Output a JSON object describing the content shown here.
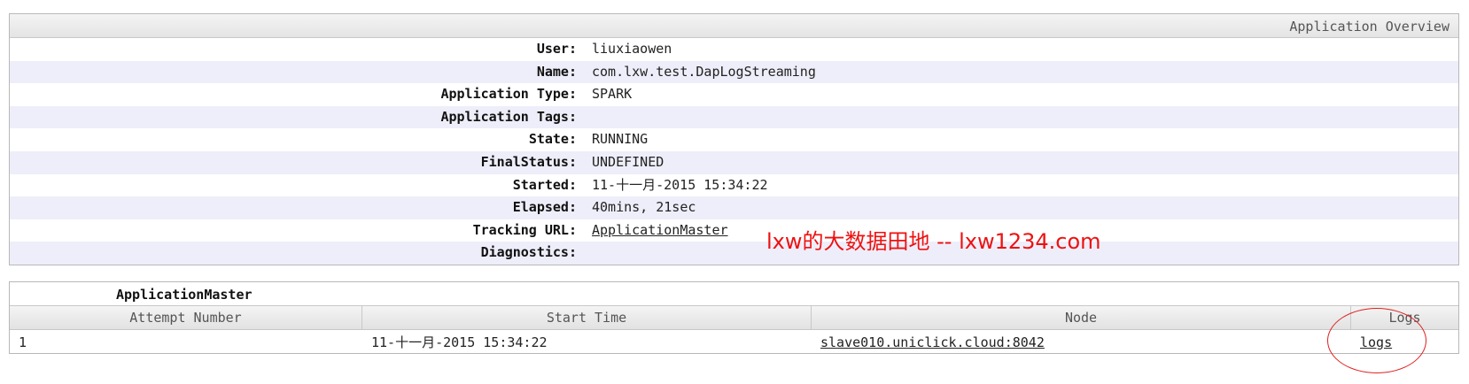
{
  "overview": {
    "header": "Application Overview",
    "rows": [
      {
        "label": "User:",
        "value": "liuxiaowen"
      },
      {
        "label": "Name:",
        "value": "com.lxw.test.DapLogStreaming"
      },
      {
        "label": "Application Type:",
        "value": "SPARK"
      },
      {
        "label": "Application Tags:",
        "value": ""
      },
      {
        "label": "State:",
        "value": "RUNNING"
      },
      {
        "label": "FinalStatus:",
        "value": "UNDEFINED"
      },
      {
        "label": "Started:",
        "value": "11-十一月-2015 15:34:22"
      },
      {
        "label": "Elapsed:",
        "value": "40mins, 21sec"
      },
      {
        "label": "Tracking URL:",
        "value": "ApplicationMaster"
      },
      {
        "label": "Diagnostics:",
        "value": ""
      }
    ]
  },
  "watermark": "lxw的大数据田地 -- lxw1234.com",
  "app_master": {
    "title": "ApplicationMaster",
    "columns": [
      "Attempt Number",
      "Start Time",
      "Node",
      "Logs"
    ],
    "rows": [
      {
        "attempt": "1",
        "start_time": "11-十一月-2015 15:34:22",
        "node": "slave010.uniclick.cloud:8042",
        "logs": "logs"
      }
    ]
  },
  "colors": {
    "alt_row": "#eeeefa",
    "annotation_red": "#e02020"
  }
}
